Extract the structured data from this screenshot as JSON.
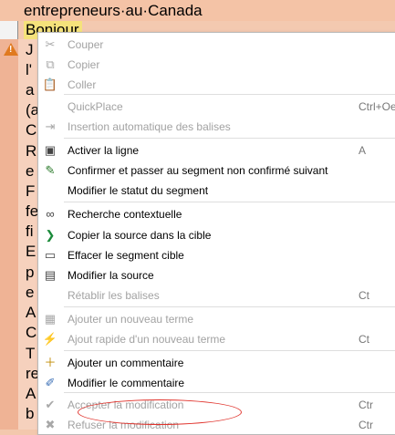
{
  "background": {
    "row1_text": "entrepreneurs·au·Canada",
    "row2_text": "Bonjour",
    "left_fragments": [
      "J",
      "l'",
      "a",
      "(a",
      "C",
      "R",
      "e",
      "F",
      "fe",
      "fi",
      "E",
      "p",
      "e",
      "A",
      "C",
      "T",
      "re",
      "A",
      "b"
    ]
  },
  "menu": {
    "items": [
      {
        "label": "Couper",
        "shortcut": "",
        "enabled": false,
        "icon": "scissors-icon",
        "glyph": "✂"
      },
      {
        "label": "Copier",
        "shortcut": "",
        "enabled": false,
        "icon": "copy-icon",
        "glyph": "⧉"
      },
      {
        "label": "Coller",
        "shortcut": "",
        "enabled": false,
        "icon": "paste-icon",
        "glyph": "📋"
      },
      {
        "label": "QuickPlace",
        "shortcut": "Ctrl+Oe",
        "enabled": false,
        "icon": "",
        "glyph": ""
      },
      {
        "label": "Insertion automatique des balises",
        "shortcut": "",
        "enabled": false,
        "icon": "tag-insert-icon",
        "glyph": "⇥"
      },
      {
        "label": "Activer la ligne",
        "shortcut": "A",
        "enabled": true,
        "icon": "activate-row-icon",
        "glyph": "▣"
      },
      {
        "label": "Confirmer et passer au segment non confirmé suivant",
        "shortcut": "",
        "enabled": true,
        "icon": "confirm-next-icon",
        "glyph": "✎"
      },
      {
        "label": "Modifier le statut du segment",
        "shortcut": "",
        "enabled": true,
        "icon": "",
        "glyph": ""
      },
      {
        "label": "Recherche contextuelle",
        "shortcut": "",
        "enabled": true,
        "icon": "binoculars-icon",
        "glyph": "∞"
      },
      {
        "label": "Copier la source dans la cible",
        "shortcut": "",
        "enabled": true,
        "icon": "copy-source-icon",
        "glyph": "❯"
      },
      {
        "label": "Effacer le segment cible",
        "shortcut": "",
        "enabled": true,
        "icon": "clear-target-icon",
        "glyph": "▭"
      },
      {
        "label": "Modifier la source",
        "shortcut": "",
        "enabled": true,
        "icon": "edit-source-icon",
        "glyph": "▤"
      },
      {
        "label": "Rétablir les balises",
        "shortcut": "Ct",
        "enabled": false,
        "icon": "",
        "glyph": ""
      },
      {
        "label": "Ajouter un nouveau terme",
        "shortcut": "",
        "enabled": false,
        "icon": "add-term-icon",
        "glyph": "▦"
      },
      {
        "label": "Ajout rapide d'un nouveau terme",
        "shortcut": "Ct",
        "enabled": false,
        "icon": "quick-term-icon",
        "glyph": "⚡"
      },
      {
        "label": "Ajouter un commentaire",
        "shortcut": "",
        "enabled": true,
        "icon": "add-comment-icon",
        "glyph": "＋"
      },
      {
        "label": "Modifier le commentaire",
        "shortcut": "",
        "enabled": true,
        "icon": "edit-comment-icon",
        "glyph": "✐"
      },
      {
        "label": "Accepter la modification",
        "shortcut": "Ctr",
        "enabled": false,
        "icon": "accept-change-icon",
        "glyph": "✔"
      },
      {
        "label": "Refuser la modification",
        "shortcut": "Ctr",
        "enabled": false,
        "icon": "reject-change-icon",
        "glyph": "✖"
      }
    ]
  },
  "colors": {
    "highlight_oval": "#e0322b",
    "segment_bg": "#f3c8ad"
  }
}
